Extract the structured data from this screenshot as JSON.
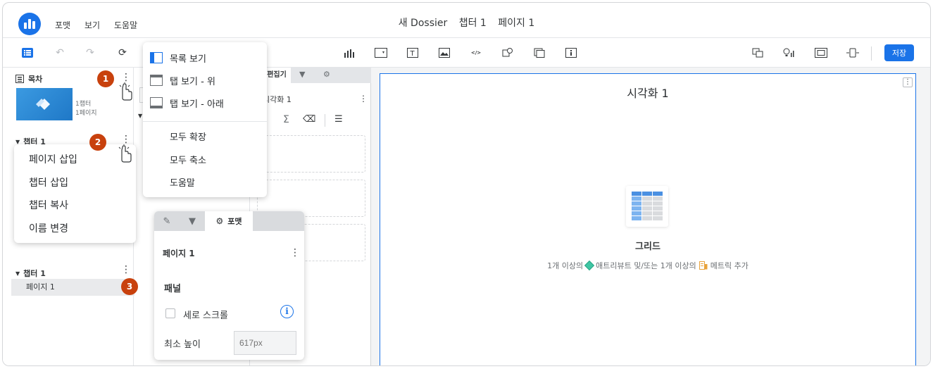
{
  "app": {
    "menu": [
      "포맷",
      "보기",
      "도움말"
    ],
    "title_parts": [
      "새 Dossier",
      "챕터 1",
      "페이지 1"
    ]
  },
  "toolbar": {
    "save_label": "저장",
    "accent": "#1a73e8"
  },
  "toc": {
    "header": "목차",
    "thumb_meta": [
      "1챕터",
      "1페이지"
    ],
    "chapters": [
      {
        "label": "챕터 1"
      },
      {
        "label": "챕터 1",
        "pages": [
          "페이지 1"
        ]
      }
    ]
  },
  "badges": [
    "1",
    "2",
    "3"
  ],
  "chapter_menu": {
    "items": [
      "페이지 삽입",
      "챕터 삽입",
      "챕터 복사",
      "이름 변경"
    ]
  },
  "view_menu": {
    "items": [
      "목록 보기",
      "탭 보기 - 위",
      "탭 보기 - 아래",
      "모두 확장",
      "모두 축소",
      "도움말"
    ]
  },
  "editor": {
    "tab_label": "편집기",
    "viz_name": "시각화 1"
  },
  "format_panel": {
    "tab_label": "포맷",
    "title": "페이지 1",
    "section": "패널",
    "checkbox_label": "세로 스크롤",
    "min_height_label": "최소 높이",
    "min_height_placeholder": "617px"
  },
  "canvas": {
    "viz_title": "시각화 1",
    "grid_label": "그리드",
    "hint_prefix": "1개 이상의",
    "hint_attribute": "애트리뷰트 및/또는 1개 이상의",
    "hint_metric": "메트릭 추가"
  }
}
